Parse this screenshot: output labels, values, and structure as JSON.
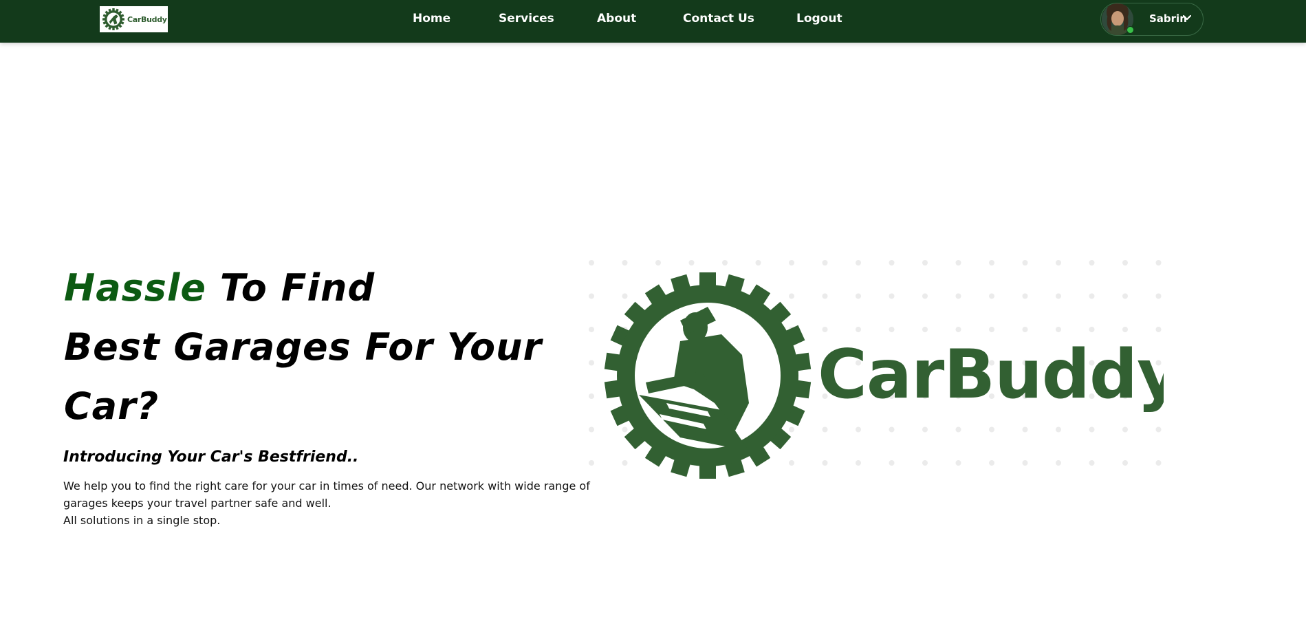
{
  "colors": {
    "navbar": "#133a1b",
    "accent": "#0c5a12",
    "logo_green": "#2f5d2f",
    "status_online": "#3ac24a"
  },
  "navbar": {
    "logo": {
      "text": "CarBuddy",
      "icon": "gear-mechanic-logo-icon"
    },
    "links": [
      "Home",
      "Services",
      "About",
      "Contact Us",
      "Logout"
    ],
    "profile": {
      "name": "Sabrin",
      "avatar": "user-avatar",
      "status": "online",
      "dropdown_icon": "chevron-down-icon"
    }
  },
  "hero": {
    "title_accent": "Hassle",
    "title_line1_rest": " To Find",
    "title_line2": "Best Garages For Your",
    "title_line3": "Car?",
    "subtitle": "Introducing Your Car's Bestfriend..",
    "description_line1": "We help you to find the right care for your car in times of need. Our network with wide range of garages keeps your travel partner safe and well.",
    "description_line2": "All solutions in a single stop.",
    "image": {
      "brand_text": "CarBuddy",
      "icon": "gear-mechanic-logo-icon"
    }
  }
}
